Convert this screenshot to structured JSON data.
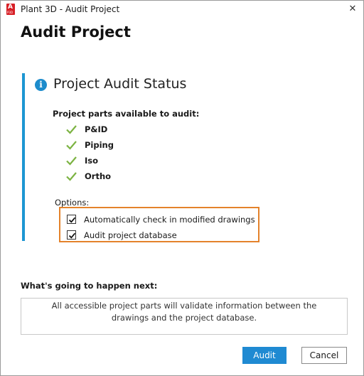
{
  "window": {
    "title": "Plant 3D - Audit Project",
    "app_logo_letter": "A",
    "app_logo_sub": "P3D",
    "close_glyph": "✕"
  },
  "page": {
    "title": "Audit Project"
  },
  "status": {
    "icon": "info-icon",
    "icon_glyph": "i",
    "title": "Project Audit Status",
    "parts_label": "Project parts available to audit:",
    "parts": [
      {
        "label": "P&ID",
        "icon": "check-icon"
      },
      {
        "label": "Piping",
        "icon": "check-icon"
      },
      {
        "label": "Iso",
        "icon": "check-icon"
      },
      {
        "label": "Ortho",
        "icon": "check-icon"
      }
    ],
    "options_label": "Options:",
    "options": [
      {
        "label": "Automatically check in modified drawings",
        "checked": true
      },
      {
        "label": "Audit project database",
        "checked": true
      }
    ]
  },
  "next": {
    "label": "What's going to happen next:",
    "line1": "All accessible project parts will validate information between the",
    "line2": "drawings and the project database."
  },
  "buttons": {
    "audit": "Audit",
    "cancel": "Cancel"
  },
  "colors": {
    "accent": "#1d96d2",
    "primary_button": "#1f8ad2",
    "check_green": "#7cb342",
    "highlight_box": "#e4822b"
  }
}
